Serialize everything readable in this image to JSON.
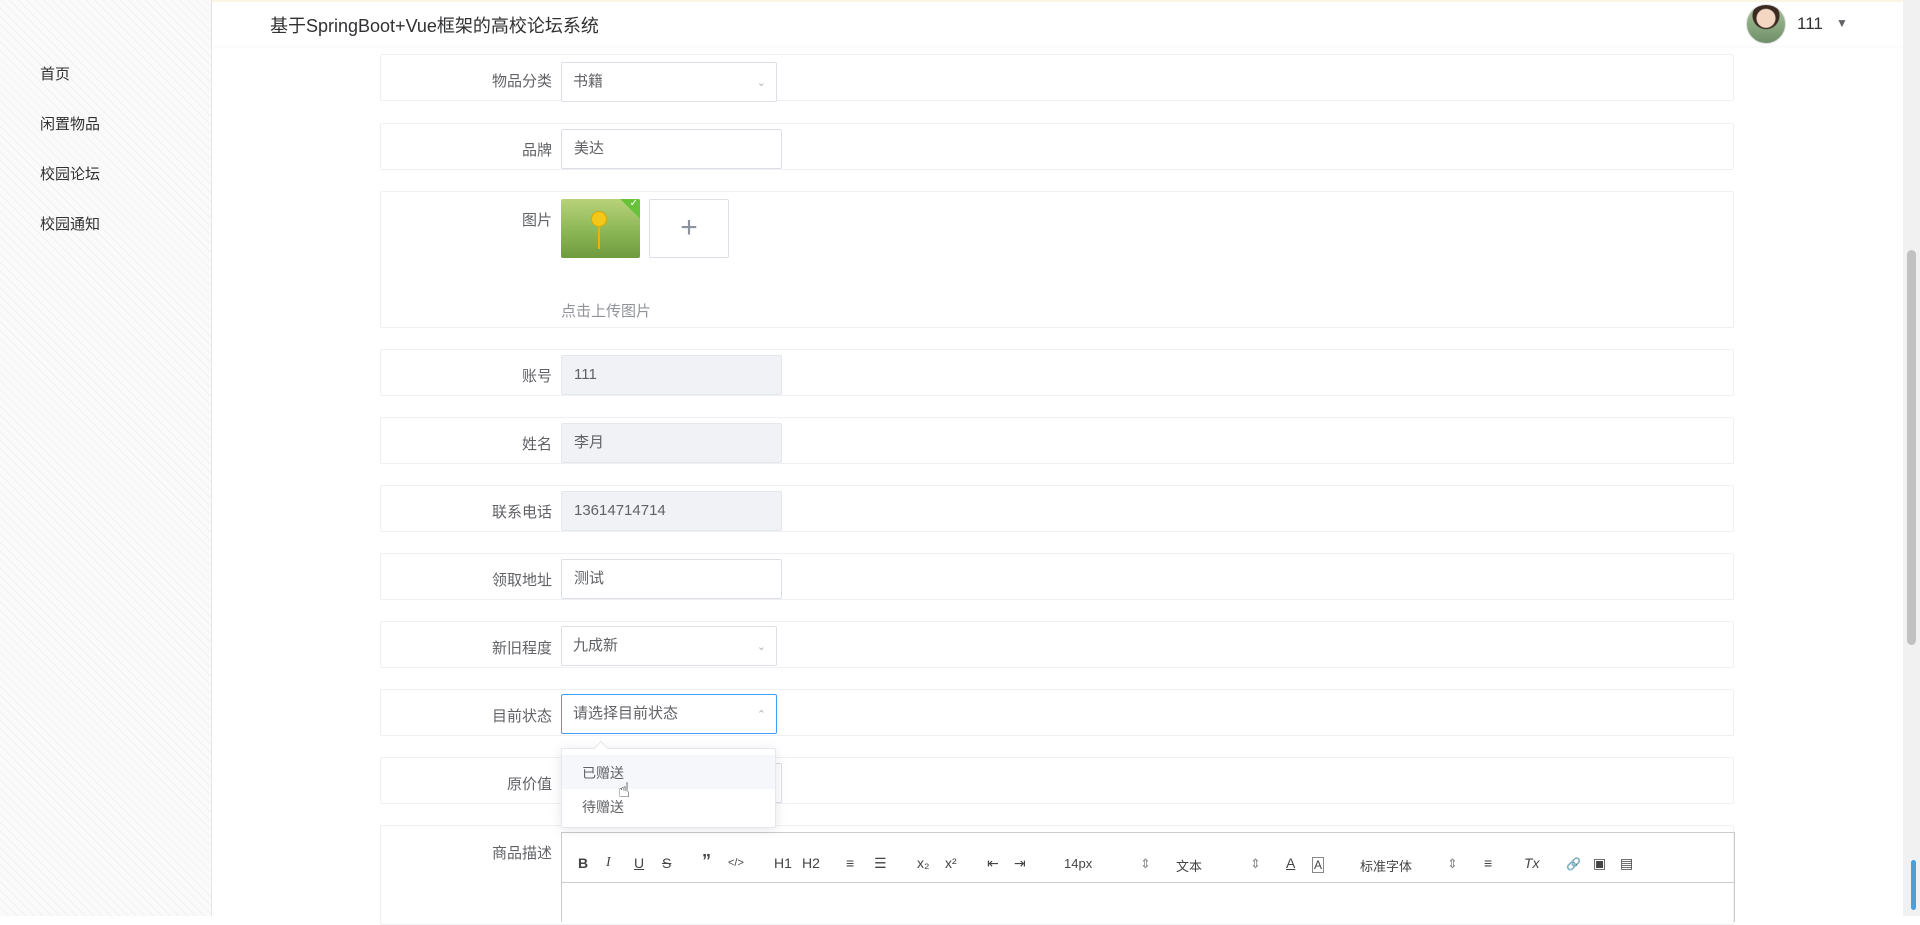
{
  "header": {
    "title": "基于SpringBoot+Vue框架的高校论坛系统",
    "user_name": "111",
    "caret": "▼"
  },
  "sidebar": {
    "items": [
      {
        "label": "首页"
      },
      {
        "label": "闲置物品"
      },
      {
        "label": "校园论坛"
      },
      {
        "label": "校园通知"
      }
    ]
  },
  "form": {
    "category": {
      "label": "物品分类",
      "value": "书籍"
    },
    "brand": {
      "label": "品牌",
      "value": "美达"
    },
    "image": {
      "label": "图片",
      "hint": "点击上传图片",
      "plus": "+",
      "check": "✓"
    },
    "account": {
      "label": "账号",
      "value": "111"
    },
    "name": {
      "label": "姓名",
      "value": "李月"
    },
    "phone": {
      "label": "联系电话",
      "value": "13614714714"
    },
    "address": {
      "label": "领取地址",
      "value": "测试"
    },
    "condition": {
      "label": "新旧程度",
      "value": "九成新"
    },
    "status": {
      "label": "目前状态",
      "placeholder": "请选择目前状态",
      "options": [
        "已赠送",
        "待赠送"
      ]
    },
    "original_price": {
      "label": "原价值"
    },
    "description": {
      "label": "商品描述"
    }
  },
  "editor": {
    "toolbar": {
      "bold": "B",
      "italic": "I",
      "underline": "U",
      "strike": "S",
      "quote": "”",
      "code": "</>",
      "h1": "H1",
      "h2": "H2",
      "ordered_list": "≡",
      "bullet_list": "☰",
      "subscript": "x₂",
      "superscript": "x²",
      "outdent": "⇤",
      "indent": "⇥",
      "font_size": "14px",
      "header": "文本",
      "font_family": "标准字体",
      "align": "≡",
      "clean": "Tx",
      "link": "🔗",
      "image": "▣",
      "video": "▤"
    }
  },
  "colors": {
    "accent": "#409eff",
    "success": "#67c23a",
    "border": "#dcdfe6"
  },
  "icons": {
    "chevron_down": "⌄",
    "chevron_up": "⌃"
  }
}
